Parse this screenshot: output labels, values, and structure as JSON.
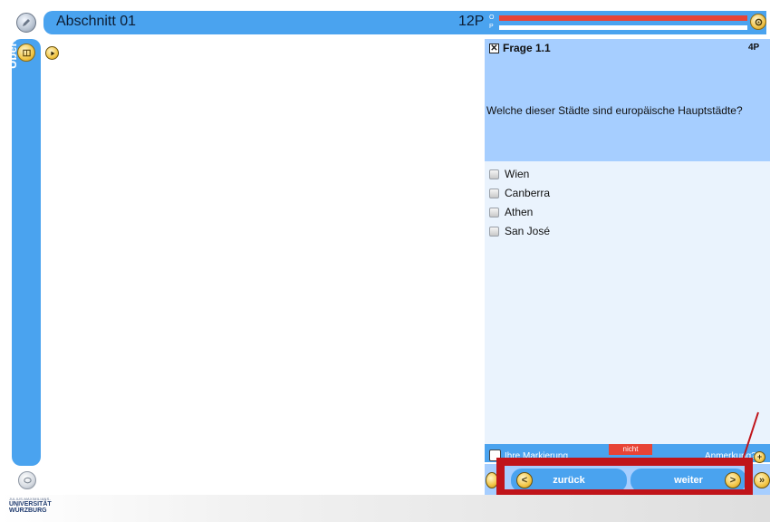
{
  "header": {
    "section_title": "Abschnitt 01",
    "points_total": "12P",
    "progress_label_top": "O",
    "progress_label_bottom": "P",
    "progress_fraction_1": 1.0,
    "progress_fraction_2": 0.0
  },
  "sidebar": {
    "label": "Übersicht und Navigation"
  },
  "question": {
    "title": "Frage 1.1",
    "points": "4P",
    "close_glyph": "✕",
    "text": "Welche dieser Städte sind europäische Hauptstädte?",
    "answers": [
      {
        "label": "Wien",
        "checked": false
      },
      {
        "label": "Canberra",
        "checked": false
      },
      {
        "label": "Athen",
        "checked": false
      },
      {
        "label": "San José",
        "checked": false
      }
    ]
  },
  "marking": {
    "label": "Ihre Markierung",
    "not_badge": "nicht",
    "note_label": "Anmerkung?",
    "note_glyph": "+"
  },
  "navigation": {
    "back_label": "zurück",
    "next_label": "weiter",
    "back_glyph": "<",
    "next_glyph": ">",
    "last_glyph": "»"
  },
  "footer": {
    "logo_top": "JULIUS-MAXIMILIANS-",
    "logo_line1": "UNIVERSITÄT",
    "logo_line2": "WÜRZBURG"
  },
  "colors": {
    "primary_blue": "#4aa3ef",
    "light_blue": "#a6ceff",
    "answer_bg": "#eaf3fd",
    "alert_red": "#e84436",
    "highlight_red": "#c0141a",
    "accent_gold": "#f2c646"
  },
  "icons": {
    "top_left": "pencil-icon",
    "top_right": "settings-icon",
    "sidebar_top": "book-icon",
    "play": "play-icon",
    "bottom_left": "chat-icon"
  }
}
